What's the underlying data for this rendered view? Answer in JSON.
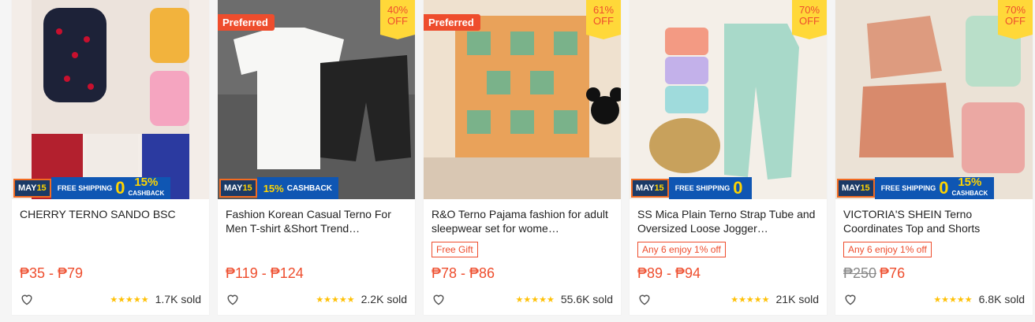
{
  "products": [
    {
      "name": "CHERRY TERNO SANDO BSC",
      "price": "₱35 - ₱79",
      "old_price": "",
      "sold": "1.7K sold",
      "stars": "★★★★★",
      "preferred": "",
      "discount_pct": "",
      "discount_off": "",
      "tag": "",
      "promo": {
        "date": "MAY",
        "date_num": "15",
        "free": "FREE SHIPPING",
        "zero": "0",
        "cashback_pct": "15%",
        "cashback_label": "CASHBACK"
      }
    },
    {
      "name": "Fashion Korean Casual Terno For Men T-shirt &Short Trend…",
      "price": "₱119 - ₱124",
      "old_price": "",
      "sold": "2.2K sold",
      "stars": "★★★★★",
      "preferred": "Preferred",
      "discount_pct": "40%",
      "discount_off": "OFF",
      "tag": "",
      "promo": {
        "date": "MAY",
        "date_num": "15",
        "cashback_text": "15%",
        "cashback_label": "CASHBACK"
      }
    },
    {
      "name": "R&O Terno Pajama fashion for adult sleepwear set for wome…",
      "price": "₱78 - ₱86",
      "old_price": "",
      "sold": "55.6K sold",
      "stars": "★★★★★",
      "preferred": "Preferred",
      "discount_pct": "61%",
      "discount_off": "OFF",
      "tag": "Free Gift",
      "promo": null
    },
    {
      "name": "SS Mica Plain Terno Strap Tube and Oversized Loose Jogger…",
      "price": "₱89 - ₱94",
      "old_price": "",
      "sold": "21K sold",
      "stars": "★★★★★",
      "preferred": "",
      "discount_pct": "70%",
      "discount_off": "OFF",
      "tag": "Any 6 enjoy 1% off",
      "promo": {
        "date": "MAY",
        "date_num": "15",
        "free": "FREE SHIPPING",
        "zero": "0"
      }
    },
    {
      "name": "VICTORIA'S SHEIN Terno Coordinates Top and Shorts",
      "price": "₱76",
      "old_price": "₱250",
      "sold": "6.8K sold",
      "stars": "★★★★★",
      "preferred": "",
      "discount_pct": "70%",
      "discount_off": "OFF",
      "tag": "Any 6 enjoy 1% off",
      "promo": {
        "date": "MAY",
        "date_num": "15",
        "free": "FREE SHIPPING",
        "zero": "0",
        "cashback_pct": "15%",
        "cashback_label": "CASHBACK"
      }
    }
  ],
  "colors": {
    "accent": "#ee4d2d",
    "preferred_bg": "#ee4d2d",
    "discount_bg": "#ffd839",
    "star": "#ffc107",
    "promo_navy": "#1b3a66",
    "promo_blue": "#0f56b3"
  }
}
